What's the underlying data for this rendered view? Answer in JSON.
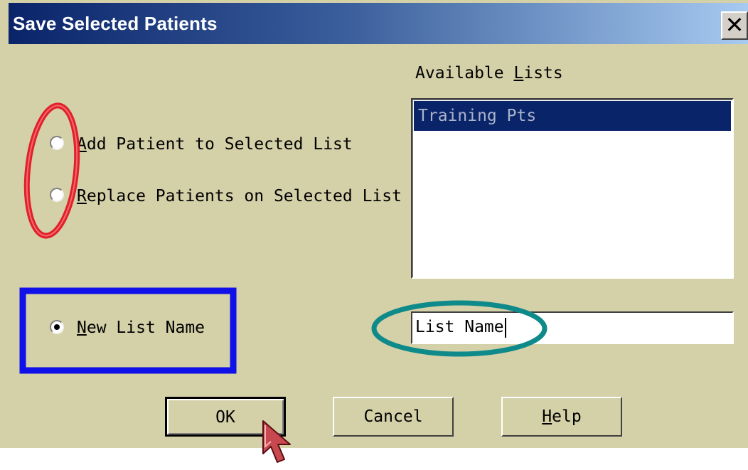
{
  "dialog": {
    "title": "Save Selected Patients",
    "close_glyph": "✕"
  },
  "options": {
    "add_prefix": "A",
    "add_rest": "dd Patient to Selected List",
    "replace_prefix": "R",
    "replace_rest": "eplace Patients on Selected List",
    "new_prefix": "N",
    "new_rest": "ew List Name",
    "selected": "new_list_name"
  },
  "available_lists": {
    "label_pre": "Available ",
    "label_ul": "L",
    "label_post": "ists",
    "items": [
      "Training Pts"
    ]
  },
  "new_list_input": {
    "value": "List Name"
  },
  "buttons": {
    "ok": "OK",
    "cancel": "Cancel",
    "help_ul": "H",
    "help_rest": "elp"
  },
  "annotations": {
    "radio_highlight_color": "#e0202a",
    "new_list_box_color": "#1010e8",
    "input_highlight_color": "#0f8a8a"
  }
}
